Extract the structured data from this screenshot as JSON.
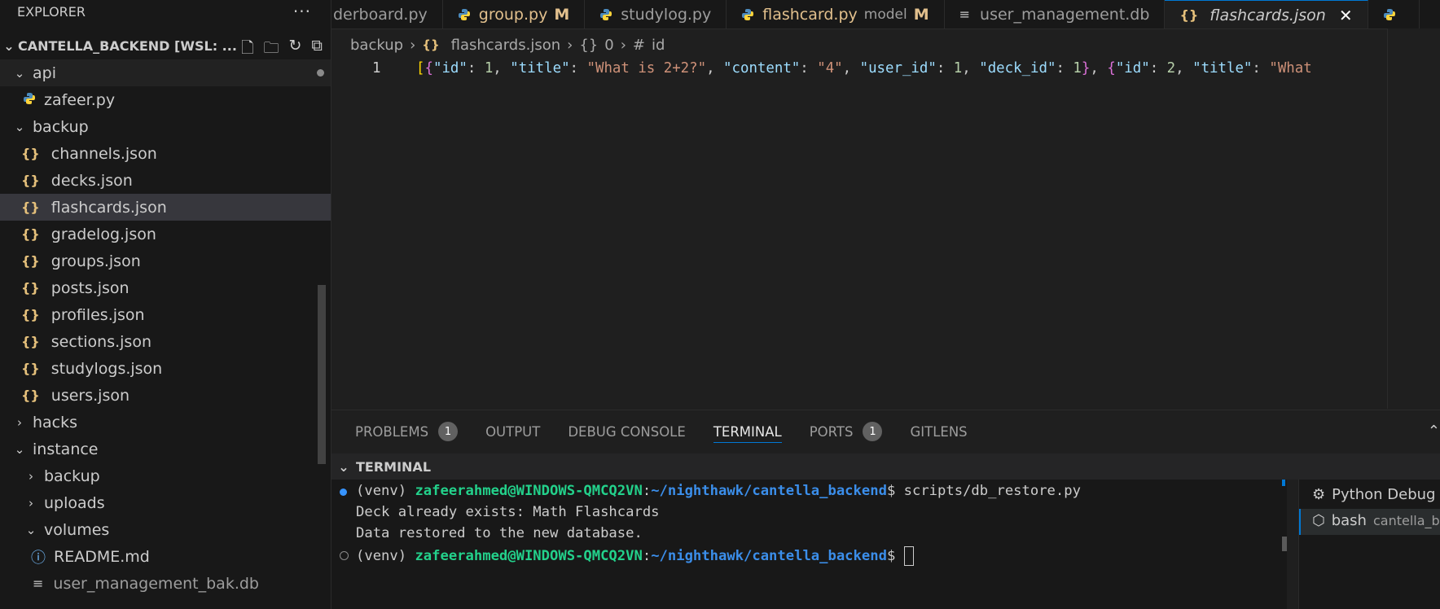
{
  "explorer": {
    "title": "EXPLORER",
    "more": "···",
    "project": "CANTELLA_BACKEND [WSL: ...",
    "tree": [
      {
        "label": "api",
        "kind": "folder-open"
      },
      {
        "label": "zafeer.py",
        "kind": "python"
      },
      {
        "label": "backup",
        "kind": "folder-open"
      },
      {
        "label": "channels.json",
        "kind": "json"
      },
      {
        "label": "decks.json",
        "kind": "json"
      },
      {
        "label": "flashcards.json",
        "kind": "json"
      },
      {
        "label": "gradelog.json",
        "kind": "json"
      },
      {
        "label": "groups.json",
        "kind": "json"
      },
      {
        "label": "posts.json",
        "kind": "json"
      },
      {
        "label": "profiles.json",
        "kind": "json"
      },
      {
        "label": "sections.json",
        "kind": "json"
      },
      {
        "label": "studylogs.json",
        "kind": "json"
      },
      {
        "label": "users.json",
        "kind": "json"
      },
      {
        "label": "hacks",
        "kind": "folder-closed"
      },
      {
        "label": "instance",
        "kind": "folder-open"
      },
      {
        "label": "backup",
        "kind": "folder-closed"
      },
      {
        "label": "uploads",
        "kind": "folder-closed"
      },
      {
        "label": "volumes",
        "kind": "folder-open"
      },
      {
        "label": "README.md",
        "kind": "info"
      },
      {
        "label": "user_management_bak.db",
        "kind": "file"
      }
    ]
  },
  "tabs": [
    {
      "label": "derboard.py",
      "mod": ""
    },
    {
      "label": "group.py",
      "mod": "M"
    },
    {
      "label": "studylog.py",
      "mod": ""
    },
    {
      "label": "flashcard.py",
      "sub": "model",
      "mod": "M"
    },
    {
      "label": "user_management.db",
      "mod": ""
    },
    {
      "label": "flashcards.json",
      "mod": ""
    }
  ],
  "breadcrumb": {
    "a": "backup",
    "b": "flashcards.json",
    "c": "0",
    "d": "id"
  },
  "editor": {
    "line_number": "1"
  },
  "panel": {
    "tabs": [
      "PROBLEMS",
      "OUTPUT",
      "DEBUG CONSOLE",
      "TERMINAL",
      "PORTS",
      "GITLENS"
    ],
    "problems_count": "1",
    "ports_count": "1",
    "terminal_header": "TERMINAL"
  },
  "terminal": {
    "prefix": "(venv) ",
    "user": "zafeerahmed@WINDOWS-QMCQ2VN",
    "path": "~/nighthawk/cantella_backend",
    "command": "scripts/db_restore.py",
    "out1": "Deck already exists: Math Flashcards",
    "out2": "Data restored to the new database."
  },
  "terminal_list": [
    {
      "label": "Python Debug"
    },
    {
      "label": "bash",
      "sub": "cantella_ba"
    }
  ],
  "colors": {
    "accent": "#0078d4",
    "modified": "#e2c08d"
  }
}
